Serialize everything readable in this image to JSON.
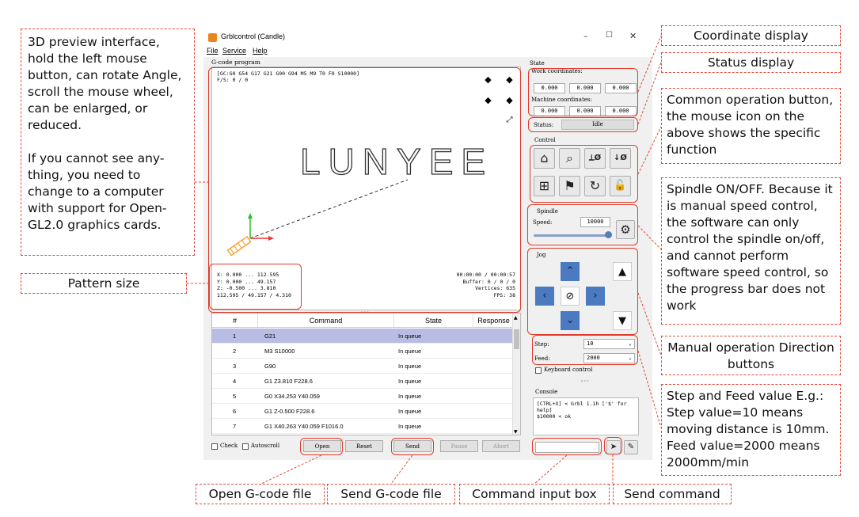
{
  "annotations": {
    "preview_p1": "3D preview interface, hold the left mouse button, can rotate Angle, scroll the mouse wheel, can be enlarged, or reduced.",
    "preview_p2": "If you cannot see any-thing, you need to change to a computer with support for Open-GL2.0 graphics cards.",
    "pattern_size": "Pattern size",
    "coordinate_display": "Coordinate display",
    "status_display": "Status display",
    "common_ops": "Common operation button, the mouse icon on the above shows the specific function",
    "spindle": "Spindle ON/OFF. Because it is manual speed control, the software can only control the spindle on/off, and cannot perform software speed control, so the progress bar does not work",
    "manual_ops": "Manual operation Direction buttons",
    "step_feed": "Step and Feed value E.g.: Step value=10 means moving distance is 10mm. Feed value=2000 means 2000mm/min",
    "open_file": "Open G-code file",
    "send_file": "Send G-code file",
    "cmd_input": "Command input box",
    "send_cmd": "Send command"
  },
  "window": {
    "title": "Grblcontrol (Candle)",
    "menu": [
      "File",
      "Service",
      "Help"
    ],
    "controls": [
      "–",
      "☐",
      "✕"
    ]
  },
  "gcode": {
    "group_label": "G-code program",
    "status_line1": "[GC:G0 G54 G17 G21 G90 G94 M5 M9 T0 F0 S10000]",
    "status_line2": "F/S: 0 / 0",
    "logo": "LUNYEE",
    "stats_left": [
      "X: 0.000 ... 112.595",
      "Y: 0.000 ... 49.157",
      "Z: -0.500 ... 3.810",
      "112.595 / 49.157 / 4.310"
    ],
    "stats_right": [
      "00:00:00 / 00:00:57",
      "Buffer: 0 / 0 / 0",
      "Vertices: 635",
      "FPS: 38"
    ]
  },
  "table": {
    "headers": [
      "#",
      "Command",
      "State",
      "Response"
    ],
    "rows": [
      {
        "n": "1",
        "cmd": "G21",
        "state": "In queue"
      },
      {
        "n": "2",
        "cmd": "M3 S10000",
        "state": "In queue"
      },
      {
        "n": "3",
        "cmd": "G90",
        "state": "In queue"
      },
      {
        "n": "4",
        "cmd": "G1 Z3.810 F228.6",
        "state": "In queue"
      },
      {
        "n": "5",
        "cmd": "G0 X34.253 Y40.059",
        "state": "In queue"
      },
      {
        "n": "6",
        "cmd": "G1 Z-0.500 F228.6",
        "state": "In queue"
      },
      {
        "n": "7",
        "cmd": "G1 X40.263 Y40.059 F1016.0",
        "state": "In queue"
      }
    ]
  },
  "bottom": {
    "check": "Check",
    "autoscroll": "Autoscroll",
    "open": "Open",
    "reset": "Reset",
    "send": "Send",
    "pause": "Pause",
    "abort": "Abort"
  },
  "state": {
    "label": "State",
    "work_label": "Work coordinates:",
    "work": [
      "0.000",
      "0.000",
      "0.000"
    ],
    "machine_label": "Machine coordinates:",
    "machine": [
      "0.000",
      "0.000",
      "0.000"
    ],
    "status_label": "Status:",
    "status_value": "Idle"
  },
  "control": {
    "label": "Control"
  },
  "spindle": {
    "label": "Spindle",
    "speed_label": "Speed:",
    "speed_value": "10000"
  },
  "jog": {
    "label": "Jog",
    "step_label": "Step:",
    "step_value": "10",
    "feed_label": "Feed:",
    "feed_value": "2000",
    "keyboard": "Keyboard control"
  },
  "console": {
    "label": "Console",
    "lines": [
      "[CTRL+X] < Grbl 1.1h ['$' for",
      "help]",
      "$10000 < ok"
    ]
  }
}
